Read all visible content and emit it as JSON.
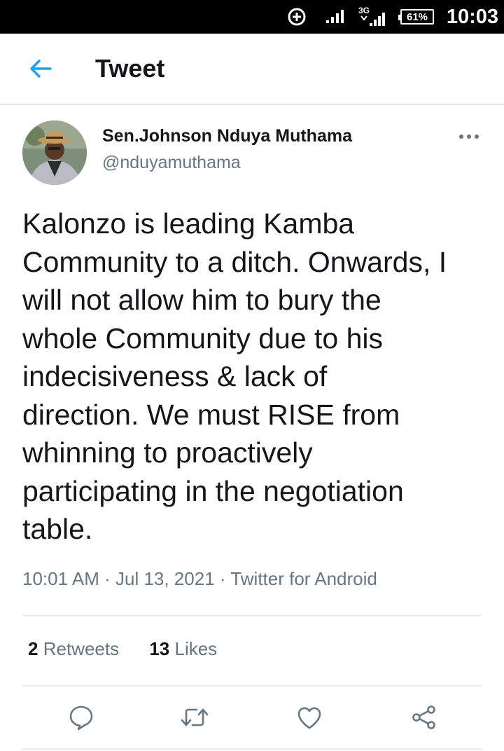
{
  "status_bar": {
    "signal_label": "3G",
    "battery": "61%",
    "time": "10:03"
  },
  "header": {
    "title": "Tweet"
  },
  "tweet": {
    "author_name": "Sen.Johnson Nduya Muthama",
    "author_handle": "@nduyamuthama",
    "text": "Kalonzo is leading Kamba\nCommunity to a ditch. Onwards, I\nwill not allow him to bury the\nwhole Community due to his\nindecisiveness & lack of\ndirection. We must RISE from\nwhinning to proactively\nparticipating in the negotiation\ntable.",
    "time": "10:01 AM",
    "date": "Jul 13, 2021",
    "source": "Twitter for Android",
    "retweets_count": "2",
    "retweets_label": "Retweets",
    "likes_count": "13",
    "likes_label": "Likes"
  },
  "colors": {
    "accent": "#1da1f2",
    "secondary_text": "#657786",
    "primary_text": "#14171a",
    "divider": "#e6ecf0"
  },
  "icons": {
    "back": "arrow-left-icon",
    "more": "more-dots-icon",
    "reply": "reply-icon",
    "retweet": "retweet-icon",
    "like": "heart-icon",
    "share": "share-icon"
  }
}
